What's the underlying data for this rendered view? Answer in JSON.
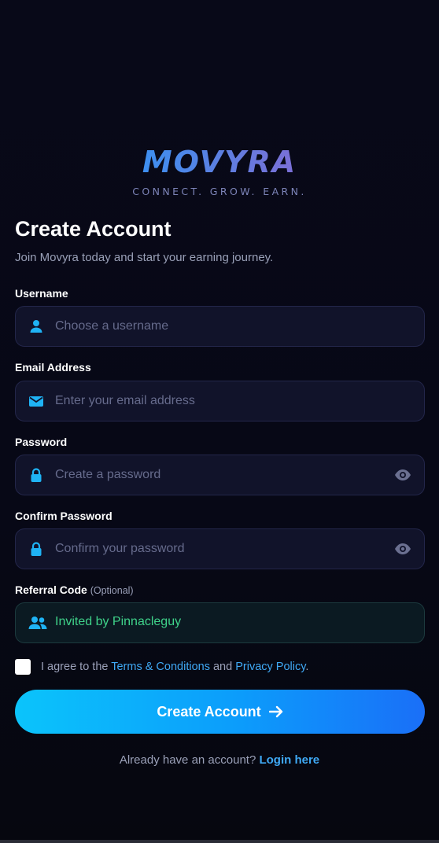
{
  "brand": {
    "name": "MOVYRA",
    "tagline": "CONNECT. GROW. EARN."
  },
  "header": {
    "title": "Create Account",
    "subtitle": "Join Movyra today and start your earning journey."
  },
  "form": {
    "username": {
      "label": "Username",
      "placeholder": "Choose a username",
      "icon": "user-icon"
    },
    "email": {
      "label": "Email Address",
      "placeholder": "Enter your email address",
      "icon": "envelope-icon"
    },
    "password": {
      "label": "Password",
      "placeholder": "Create a password",
      "icon": "lock-icon"
    },
    "confirm_password": {
      "label": "Confirm Password",
      "placeholder": "Confirm your password",
      "icon": "lock-icon"
    },
    "referral": {
      "label": "Referral Code",
      "optional": "(Optional)",
      "value": "Invited by Pinnacleguy",
      "icon": "users-icon"
    }
  },
  "agreement": {
    "prefix": "I agree to the",
    "terms": "Terms & Conditions",
    "middle": "and",
    "privacy": "Privacy Policy",
    "suffix": ".",
    "checked": false
  },
  "submit": {
    "label": "Create Account"
  },
  "login": {
    "prompt": "Already have an account?",
    "link": "Login here"
  },
  "colors": {
    "background": "#070816",
    "accent": "#3fa9f5",
    "button_start": "#0bc4fb",
    "button_end": "#1a6ff8",
    "referral_text": "#3fd38a",
    "muted_text": "#9aa0b8"
  }
}
